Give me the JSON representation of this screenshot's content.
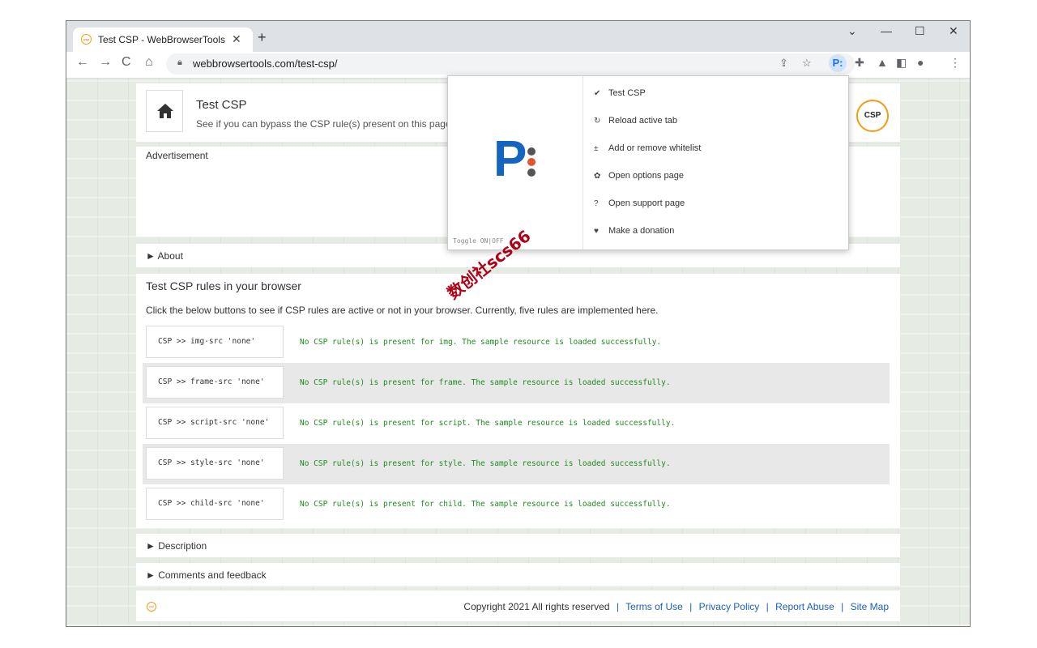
{
  "browser": {
    "tab_title": "Test CSP - WebBrowserTools",
    "tab_close": "✕",
    "new_tab": "+",
    "url": "webbrowsertools.com/test-csp/",
    "win_controls": {
      "chevron": "⌄",
      "minimize": "—",
      "maximize": "☐",
      "close": "✕"
    },
    "extension_badge": "P:"
  },
  "page": {
    "header": {
      "title": "Test CSP",
      "subtitle": "See if you can bypass the CSP rule(s) present on this page",
      "logo_text": "CSP"
    },
    "advertisement_label": "Advertisement",
    "about_label": "► About",
    "section_title": "Test CSP rules in your browser",
    "section_intro": "Click the below buttons to see if CSP rules are active or not in your browser. Currently, five rules are implemented here.",
    "rules": [
      {
        "label": "CSP >> img-src 'none'",
        "result": "No CSP rule(s) is present for img. The sample resource is loaded successfully."
      },
      {
        "label": "CSP >> frame-src 'none'",
        "result": "No CSP rule(s) is present for frame. The sample resource is loaded successfully."
      },
      {
        "label": "CSP >> script-src 'none'",
        "result": "No CSP rule(s) is present for script. The sample resource is loaded successfully."
      },
      {
        "label": "CSP >> style-src 'none'",
        "result": "No CSP rule(s) is present for style. The sample resource is loaded successfully."
      },
      {
        "label": "CSP >> child-src 'none'",
        "result": "No CSP rule(s) is present for child. The sample resource is loaded successfully."
      }
    ],
    "description_label": "► Description",
    "comments_label": "► Comments and feedback",
    "footer": {
      "copyright": "Copyright 2021 All rights reserved",
      "links": [
        "Terms of Use",
        "Privacy Policy",
        "Report Abuse",
        "Site Map"
      ],
      "separator": "|"
    }
  },
  "popup": {
    "logo_letter": "P",
    "toggle_label": "Toggle ON|OFF",
    "menu": [
      {
        "icon": "✔",
        "label": "Test CSP"
      },
      {
        "icon": "↻",
        "label": "Reload active tab"
      },
      {
        "icon": "±",
        "label": "Add or remove whitelist"
      },
      {
        "icon": "✿",
        "label": "Open options page"
      },
      {
        "icon": "?",
        "label": "Open support page"
      },
      {
        "icon": "♥",
        "label": "Make a donation"
      }
    ]
  },
  "watermark": "数创社scs66",
  "colors": {
    "accent": "#1a73e8",
    "result_green": "#1e8c1e",
    "logo_orange": "#f39c12",
    "p_blue": "#1565c0"
  }
}
